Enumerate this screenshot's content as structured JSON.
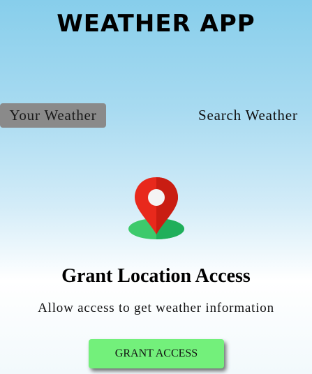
{
  "header": {
    "title": "WEATHER APP"
  },
  "tabs": [
    {
      "label": "Your Weather",
      "active": true
    },
    {
      "label": "Search Weather",
      "active": false
    }
  ],
  "location_prompt": {
    "icon": "location-pin-icon",
    "title": "Grant Location Access",
    "description": "Allow access to get weather information",
    "button_label": "GRANT ACCESS"
  },
  "colors": {
    "active_tab": "#8a8a8a",
    "button": "#73f07b",
    "pin_red": "#e8291c",
    "pin_base_green": "#3dca6c"
  }
}
